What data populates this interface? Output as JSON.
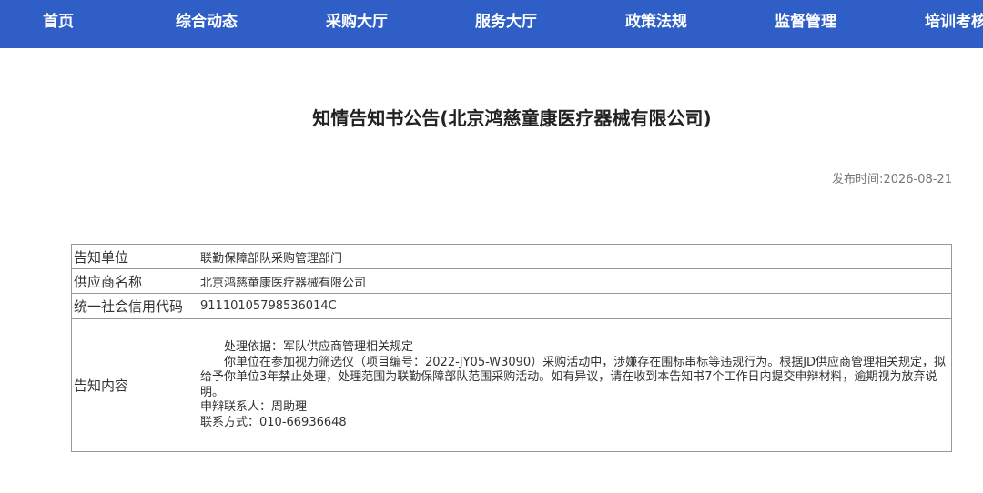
{
  "nav": {
    "items": [
      "首页",
      "综合动态",
      "采购大厅",
      "服务大厅",
      "政策法规",
      "监督管理",
      "培训考核"
    ]
  },
  "page_title": "知情告知书公告(北京鸿慈童康医疗器械有限公司)",
  "publish": {
    "label": "发布时间:",
    "date": "2026-08-21"
  },
  "table": {
    "rows": [
      {
        "label": "告知单位",
        "value": "联勤保障部队采购管理部门"
      },
      {
        "label": "供应商名称",
        "value": "北京鸿慈童康医疗器械有限公司"
      },
      {
        "label": "统一社会信用代码",
        "value": "91110105798536014C"
      }
    ],
    "content": {
      "label": "告知内容",
      "basis": "处理依据：军队供应商管理相关规定",
      "body": "你单位在参加视力筛选仪（项目编号：2022-JY05-W3090）采购活动中，涉嫌存在围标串标等违规行为。根据JD供应商管理相关规定，拟给予你单位3年禁止处理，处理范围为联勤保障部队范围采购活动。如有异议，请在收到本告知书7个工作日内提交申辩材料，逾期视为放弃说明。",
      "contact_person": "申辩联系人：周助理",
      "contact_phone": "联系方式：010-66936648"
    }
  },
  "colors": {
    "nav_bg": "#2f5fc6",
    "nav_text": "#ffffff",
    "border": "#999999"
  }
}
